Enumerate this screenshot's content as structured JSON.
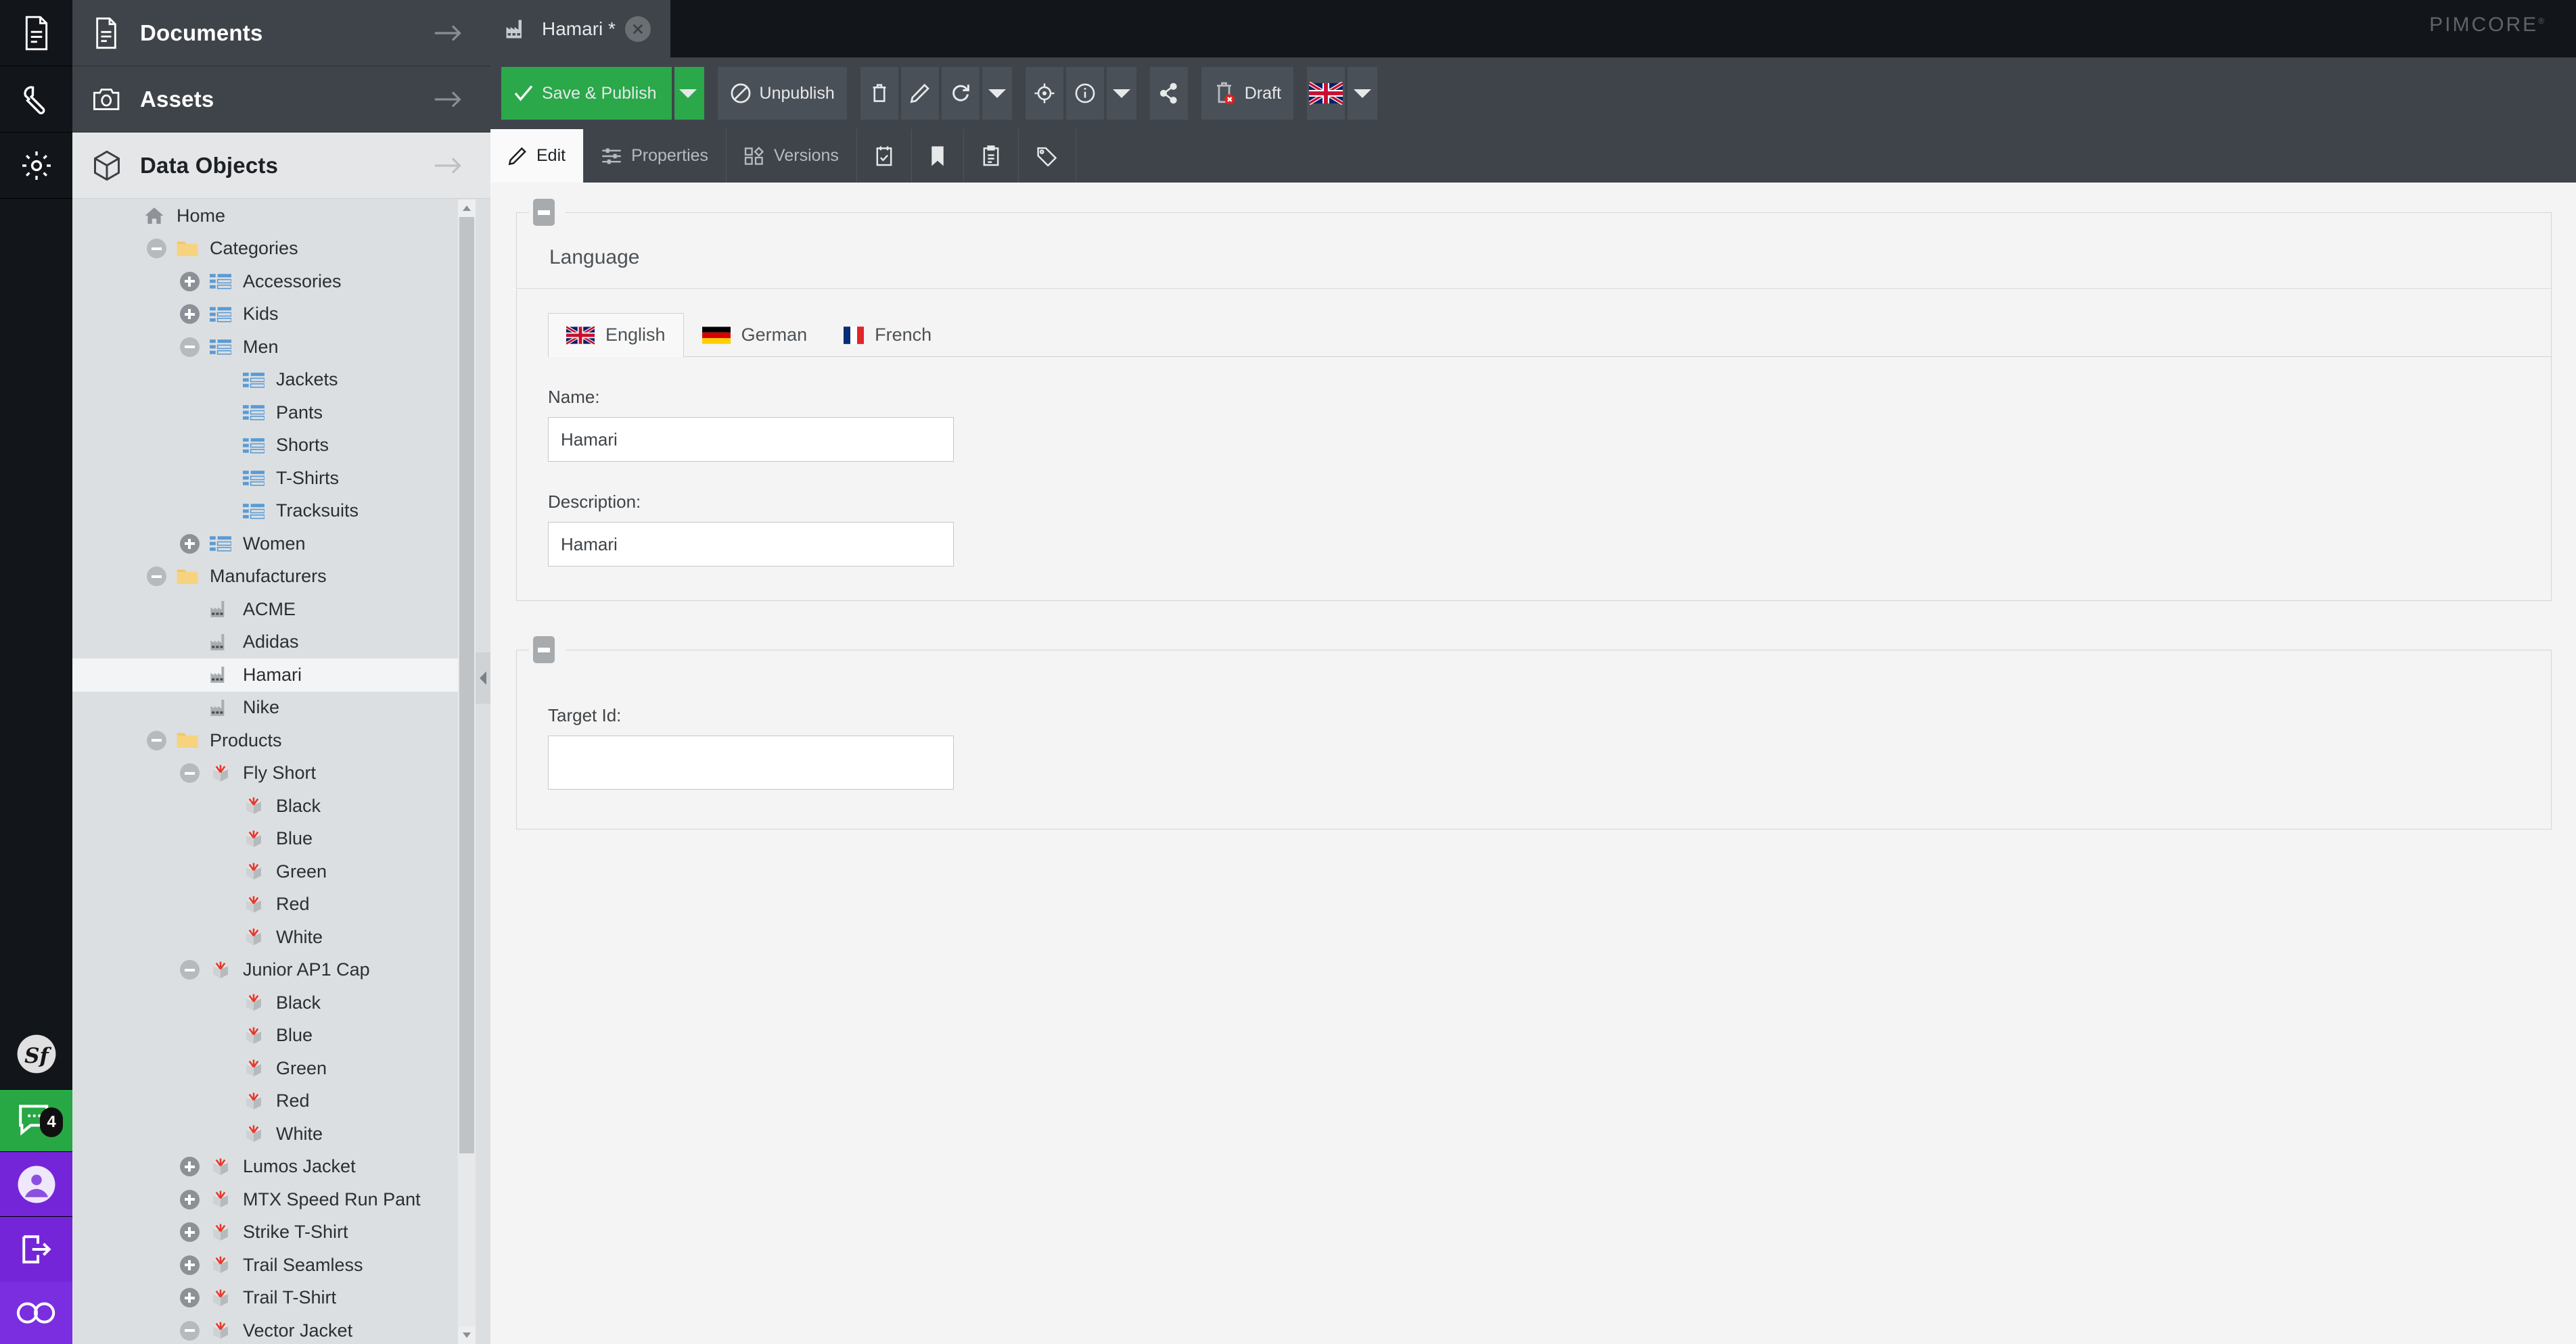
{
  "brand": {
    "logo_text": "PIMCORE",
    "registered_mark": "®"
  },
  "icon_rail": {
    "items": [
      {
        "name": "documents-rail-icon",
        "icon": "file-icon"
      },
      {
        "name": "settings-tools-rail-icon",
        "icon": "wrench-icon"
      },
      {
        "name": "system-settings-rail-icon",
        "icon": "gear-icon"
      }
    ],
    "bottom": [
      {
        "name": "symfony-profiler",
        "icon": "symfony-logo-icon",
        "color": "#12151a"
      },
      {
        "name": "notifications",
        "icon": "comment-icon",
        "badge": "4",
        "color": "#28a745"
      },
      {
        "name": "user-profile",
        "icon": "user-avatar-icon",
        "color": "#7425d8"
      },
      {
        "name": "logout",
        "icon": "logout-arrow-icon",
        "color": "#7425d8"
      },
      {
        "name": "pimcore-loop",
        "icon": "infinity-icon",
        "color": "#7b2ee0"
      }
    ]
  },
  "sidebar": {
    "sections": [
      {
        "label": "Documents",
        "icon": "document-icon",
        "active": false
      },
      {
        "label": "Assets",
        "icon": "camera-icon",
        "active": false
      },
      {
        "label": "Data Objects",
        "icon": "cube-icon",
        "active": true
      }
    ],
    "tree": [
      {
        "label": "Home",
        "indent": 0,
        "toggle": "none",
        "icon": "home-icon"
      },
      {
        "label": "Categories",
        "indent": 1,
        "toggle": "minus",
        "icon": "folder-icon"
      },
      {
        "label": "Accessories",
        "indent": 2,
        "toggle": "plus",
        "icon": "object-list-icon"
      },
      {
        "label": "Kids",
        "indent": 2,
        "toggle": "plus",
        "icon": "object-list-icon"
      },
      {
        "label": "Men",
        "indent": 2,
        "toggle": "minus",
        "icon": "object-list-icon"
      },
      {
        "label": "Jackets",
        "indent": 3,
        "toggle": "none",
        "icon": "object-list-icon"
      },
      {
        "label": "Pants",
        "indent": 3,
        "toggle": "none",
        "icon": "object-list-icon"
      },
      {
        "label": "Shorts",
        "indent": 3,
        "toggle": "none",
        "icon": "object-list-icon"
      },
      {
        "label": "T-Shirts",
        "indent": 3,
        "toggle": "none",
        "icon": "object-list-icon"
      },
      {
        "label": "Tracksuits",
        "indent": 3,
        "toggle": "none",
        "icon": "object-list-icon"
      },
      {
        "label": "Women",
        "indent": 2,
        "toggle": "plus",
        "icon": "object-list-icon"
      },
      {
        "label": "Manufacturers",
        "indent": 1,
        "toggle": "minus",
        "icon": "folder-icon"
      },
      {
        "label": "ACME",
        "indent": 2,
        "toggle": "none",
        "icon": "factory-icon"
      },
      {
        "label": "Adidas",
        "indent": 2,
        "toggle": "none",
        "icon": "factory-icon"
      },
      {
        "label": "Hamari",
        "indent": 2,
        "toggle": "none",
        "icon": "factory-icon",
        "selected": true
      },
      {
        "label": "Nike",
        "indent": 2,
        "toggle": "none",
        "icon": "factory-icon"
      },
      {
        "label": "Products",
        "indent": 1,
        "toggle": "minus",
        "icon": "folder-icon"
      },
      {
        "label": "Fly Short",
        "indent": 2,
        "toggle": "minus",
        "icon": "package-icon"
      },
      {
        "label": "Black",
        "indent": 3,
        "toggle": "none",
        "icon": "package-icon"
      },
      {
        "label": "Blue",
        "indent": 3,
        "toggle": "none",
        "icon": "package-icon"
      },
      {
        "label": "Green",
        "indent": 3,
        "toggle": "none",
        "icon": "package-icon"
      },
      {
        "label": "Red",
        "indent": 3,
        "toggle": "none",
        "icon": "package-icon"
      },
      {
        "label": "White",
        "indent": 3,
        "toggle": "none",
        "icon": "package-icon"
      },
      {
        "label": "Junior AP1 Cap",
        "indent": 2,
        "toggle": "minus",
        "icon": "package-icon"
      },
      {
        "label": "Black",
        "indent": 3,
        "toggle": "none",
        "icon": "package-icon"
      },
      {
        "label": "Blue",
        "indent": 3,
        "toggle": "none",
        "icon": "package-icon"
      },
      {
        "label": "Green",
        "indent": 3,
        "toggle": "none",
        "icon": "package-icon"
      },
      {
        "label": "Red",
        "indent": 3,
        "toggle": "none",
        "icon": "package-icon"
      },
      {
        "label": "White",
        "indent": 3,
        "toggle": "none",
        "icon": "package-icon"
      },
      {
        "label": "Lumos Jacket",
        "indent": 2,
        "toggle": "plus",
        "icon": "package-icon"
      },
      {
        "label": "MTX Speed Run Pant",
        "indent": 2,
        "toggle": "plus",
        "icon": "package-icon"
      },
      {
        "label": "Strike T-Shirt",
        "indent": 2,
        "toggle": "plus",
        "icon": "package-icon"
      },
      {
        "label": "Trail Seamless",
        "indent": 2,
        "toggle": "plus",
        "icon": "package-icon"
      },
      {
        "label": "Trail T-Shirt",
        "indent": 2,
        "toggle": "plus",
        "icon": "package-icon"
      },
      {
        "label": "Vector Jacket",
        "indent": 2,
        "toggle": "minus",
        "icon": "package-icon"
      }
    ]
  },
  "document_tab": {
    "title": "Hamari *",
    "icon": "factory-icon",
    "close_icon": "close-icon"
  },
  "toolbar": {
    "save_publish_label": "Save & Publish",
    "unpublish_label": "Unpublish",
    "draft_label": "Draft",
    "icons": [
      {
        "name": "delete-button",
        "icon": "trash-icon"
      },
      {
        "name": "rename-button",
        "icon": "pencil-icon"
      },
      {
        "name": "reload-button",
        "icon": "reload-icon"
      },
      {
        "name": "reload-menu-button",
        "icon": "caret-down-icon"
      },
      {
        "name": "locate-button",
        "icon": "target-icon"
      },
      {
        "name": "info-button",
        "icon": "info-icon"
      },
      {
        "name": "info-menu-button",
        "icon": "caret-down-icon"
      },
      {
        "name": "share-button",
        "icon": "share-icon"
      }
    ],
    "language_flag": "uk-flag-icon",
    "language_menu_icon": "caret-down-icon"
  },
  "subtabs": [
    {
      "label": "Edit",
      "icon": "pencil-icon",
      "active": true
    },
    {
      "label": "Properties",
      "icon": "sliders-icon",
      "active": false
    },
    {
      "label": "Versions",
      "icon": "blocks-icon",
      "active": false
    },
    {
      "label": "",
      "icon": "schedule-icon",
      "active": false
    },
    {
      "label": "",
      "icon": "bookmark-icon",
      "active": false
    },
    {
      "label": "",
      "icon": "clipboard-icon",
      "active": false
    },
    {
      "label": "",
      "icon": "tag-icon",
      "active": false
    }
  ],
  "main": {
    "fieldset_language": {
      "title": "Language",
      "collapse_icon": "minus-icon",
      "lang_tabs": [
        {
          "label": "English",
          "flag": "uk-flag-icon",
          "active": true
        },
        {
          "label": "German",
          "flag": "de-flag-icon",
          "active": false
        },
        {
          "label": "French",
          "flag": "fr-flag-icon",
          "active": false
        }
      ],
      "fields": [
        {
          "label": "Name:",
          "value": "Hamari",
          "placeholder": ""
        },
        {
          "label": "Description:",
          "value": "Hamari",
          "placeholder": ""
        }
      ]
    },
    "fieldset_target": {
      "collapse_icon": "minus-icon",
      "fields": [
        {
          "label": "Target Id:",
          "value": "",
          "placeholder": ""
        }
      ]
    }
  },
  "colors": {
    "accent_green": "#2aa84a",
    "rail_purple": "#7425d8",
    "notify_green": "#28a745",
    "dark_chrome": "#3f444a",
    "darkest": "#12151a",
    "content_bg": "#f4f4f4"
  }
}
